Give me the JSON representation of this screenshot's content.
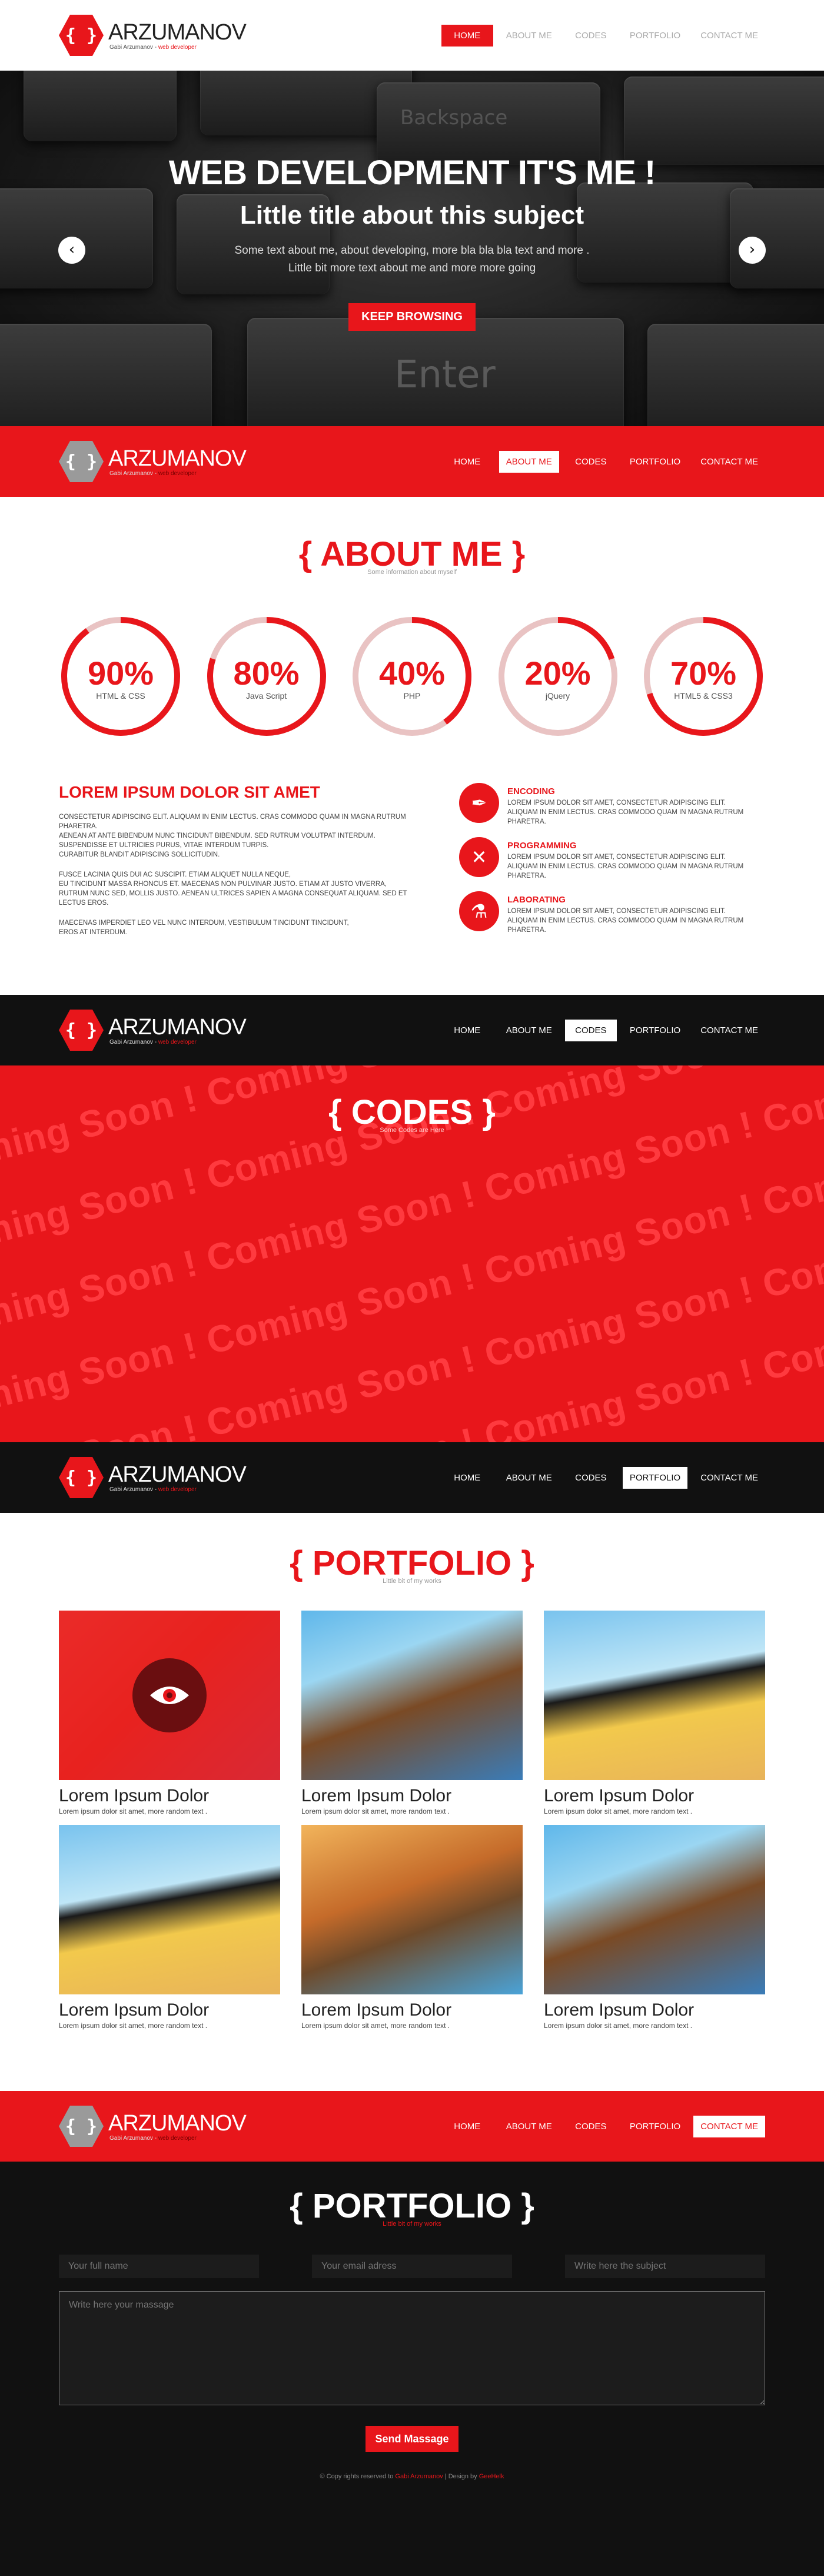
{
  "brand": {
    "logo_glyph": "{ }",
    "name": "ARZUMANOV",
    "tagline_name": "Gabi Arzumanov",
    "tagline_sep": " - ",
    "tagline_role": "web developer"
  },
  "nav": {
    "items": [
      "HOME",
      "ABOUT ME",
      "CODES",
      "PORTFOLIO",
      "CONTACT ME"
    ]
  },
  "hero": {
    "title_pre": "WEB ",
    "title_bold": "DEVELOPMENT",
    "title_post": " IT'S ME !",
    "sub_pre": "Little title about ",
    "sub_bold": "this subject",
    "text_line1": "Some text about me, about developing, more bla bla bla text and more .",
    "text_line2": "Little bit more text about me and more more going",
    "button": "KEEP BROWSING",
    "prev_arrow": "‹",
    "next_arrow": "›",
    "keys": [
      "Backspace",
      "Enter"
    ]
  },
  "about": {
    "title": "{ ABOUT ME }",
    "subtitle": "Some information about myself",
    "skills": [
      {
        "percent": 90,
        "label": "90%",
        "name": "HTML & CSS"
      },
      {
        "percent": 80,
        "label": "80%",
        "name": "Java Script"
      },
      {
        "percent": 40,
        "label": "40%",
        "name": "PHP"
      },
      {
        "percent": 20,
        "label": "20%",
        "name": "jQuery"
      },
      {
        "percent": 70,
        "label": "70%",
        "name": "HTML5 & CSS3"
      }
    ],
    "heading": "LOREM IPSUM DOLOR SIT AMET",
    "paragraph1": "Consectetur adipiscing elit. Aliquam in enim lectus. Cras commodo quam in magna rutrum pharetra.\nAenean at ante bibendum nunc tincidunt bibendum. Sed rutrum volutpat interdum.\nSuspendisse et ultricies purus, vitae interdum turpis.\nCurabitur blandit adipiscing sollicitudin.",
    "paragraph2": "Fusce lacinia quis dui ac suscipit. Etiam aliquet nulla neque,\nEu tincidunt massa rhoncus et. Maecenas non pulvinar justo. Etiam at justo viverra,\nRutrum nunc sed, mollis justo. Aenean ultrices sapien a magna consequat aliquam. Sed et lectus eros.",
    "paragraph3": "Maecenas imperdiet leo vel nunc interdum, vestibulum tincidunt tincidunt,\nEros at interdum.",
    "features": [
      {
        "icon": "pen-nib-icon",
        "glyph": "✒",
        "title": "ENCODING",
        "line1": "Lorem ipsum dolor sit amet, consectetur adipiscing elit.",
        "line2": "Aliquam in enim lectus. Cras commodo quam in magna rutrum pharetra."
      },
      {
        "icon": "tools-icon",
        "glyph": "✕",
        "title": "PROGRAMMING",
        "line1": "Lorem ipsum dolor sit amet, consectetur adipiscing elit.",
        "line2": "Aliquam in enim lectus. Cras commodo quam in magna rutrum pharetra."
      },
      {
        "icon": "flask-icon",
        "glyph": "⚗",
        "title": "LABORATING",
        "line1": "Lorem ipsum dolor sit amet, consectetur adipiscing elit.",
        "line2": "Aliquam in enim lectus. Cras commodo quam in magna rutrum pharetra."
      }
    ]
  },
  "codes": {
    "title": "{ CODES }",
    "subtitle": "Some Codes are Here",
    "watermark": "Coming Soon ! Coming Soon ! Coming Soon ! Coming Soon !"
  },
  "portfolio": {
    "title": "{ PORTFOLIO }",
    "subtitle": "Little bit of my works",
    "items": [
      {
        "title": "Lorem Ipsum Dolor",
        "desc": "Lorem ipsum dolor sit amet, more random text ."
      },
      {
        "title": "Lorem Ipsum Dolor",
        "desc": "Lorem ipsum dolor sit amet, more random text ."
      },
      {
        "title": "Lorem Ipsum Dolor",
        "desc": "Lorem ipsum dolor sit amet, more random text ."
      },
      {
        "title": "Lorem Ipsum Dolor",
        "desc": "Lorem ipsum dolor sit amet, more random text ."
      },
      {
        "title": "Lorem Ipsum Dolor",
        "desc": "Lorem ipsum dolor sit amet, more random text ."
      },
      {
        "title": "Lorem Ipsum Dolor",
        "desc": "Lorem ipsum dolor sit amet, more random text ."
      }
    ]
  },
  "contact": {
    "title": "{ PORTFOLIO }",
    "subtitle": "Little bit of my works",
    "name_placeholder": "Your full name",
    "email_placeholder": "Your email adress",
    "subject_placeholder": "Write here the subject",
    "message_placeholder": "Write here your massage",
    "button": "Send Massage"
  },
  "footer": {
    "pre": "© Copy rights reserved to ",
    "owner": "Gabi Arzumanov",
    "mid": " | Design by ",
    "designer": "GeeHelk"
  },
  "colors": {
    "accent": "#e8161b",
    "dark": "#111111",
    "ring_track": "#e9c3c3"
  }
}
